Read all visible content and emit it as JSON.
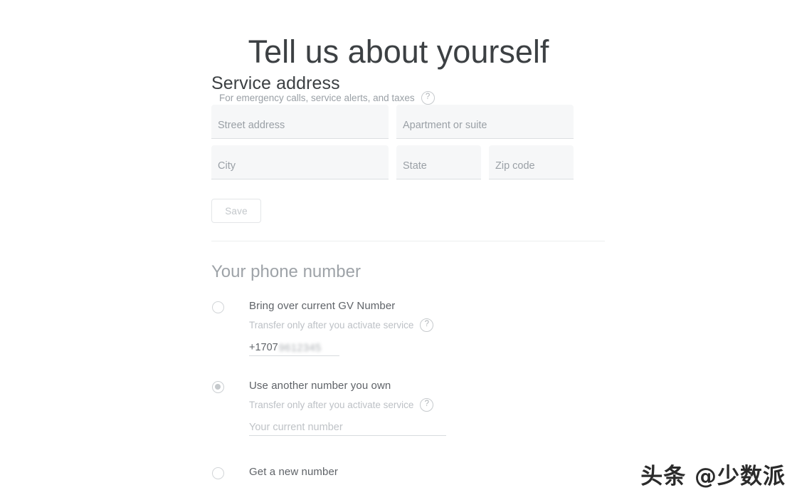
{
  "page": {
    "title": "Tell us about yourself"
  },
  "service_address": {
    "heading": "Service address",
    "subtitle": "For emergency calls, service alerts, and taxes",
    "help_icon": "help-circle-icon",
    "fields": [
      {
        "name": "street",
        "placeholder": "Street address",
        "value": ""
      },
      {
        "name": "apartment",
        "placeholder": "Apartment or suite",
        "value": ""
      },
      {
        "name": "city",
        "placeholder": "City",
        "value": ""
      },
      {
        "name": "state",
        "placeholder": "State",
        "value": ""
      },
      {
        "name": "zip",
        "placeholder": "Zip code",
        "value": ""
      }
    ],
    "save_label": "Save"
  },
  "phone_number": {
    "heading": "Your phone number",
    "options": [
      {
        "id": "bring-over-gv",
        "label": "Bring over current GV Number",
        "subtitle": "Transfer only after you activate service",
        "help_icon": "help-circle-icon",
        "selected": false,
        "input": {
          "value": "+1707",
          "redacted_suffix": "9612345",
          "placeholder": ""
        }
      },
      {
        "id": "use-another-number",
        "label": "Use another number you own",
        "subtitle": "Transfer only after you activate service",
        "help_icon": "help-circle-icon",
        "selected": true,
        "input": {
          "value": "",
          "placeholder": "Your current number"
        }
      },
      {
        "id": "get-new-number",
        "label": "Get a new number",
        "subtitle": "",
        "selected": false
      }
    ]
  },
  "watermark": {
    "text": "头条 @少数派"
  },
  "colors": {
    "title": "#3c4043",
    "heading_dark": "#3c4043",
    "heading_muted": "#9ea3a8",
    "label": "#5f6368",
    "subtitle": "#9aa0a6",
    "placeholder": "#9aa0a6",
    "field_bg": "#f6f7f8",
    "field_border": "#dcdfe2",
    "divider": "#eceeef",
    "page_bg": "#ffffff"
  }
}
